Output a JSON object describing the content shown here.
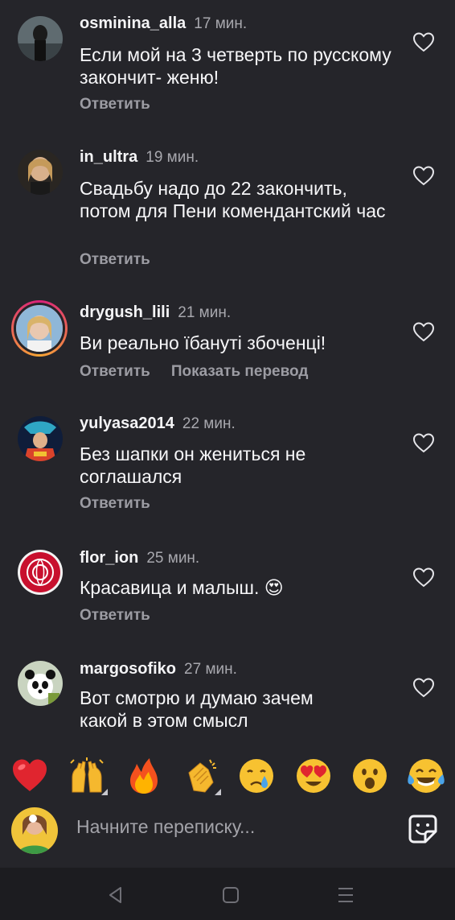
{
  "comments": [
    {
      "username": "osminina_alla",
      "time": "17 мин.",
      "text": "Если мой на 3 четверть по русскому закончит- женю!",
      "actions": [
        "Ответить"
      ]
    },
    {
      "username": "in_ultra",
      "time": "19 мин.",
      "text": "Свадьбу надо до 22 закончить, потом для Пени комендантский час",
      "actions": [
        "Ответить"
      ]
    },
    {
      "username": "drygush_lili",
      "time": "21 мин.",
      "text": "Ви реально їбануті збоченці!",
      "actions": [
        "Ответить",
        "Показать перевод"
      ]
    },
    {
      "username": "yulyasa2014",
      "time": "22 мин.",
      "text": "Без шапки он жениться не соглашался",
      "actions": [
        "Ответить"
      ]
    },
    {
      "username": "flor_ion",
      "time": "25 мин.",
      "text": "Красавица и малыш. 😍",
      "actions": [
        "Ответить"
      ]
    },
    {
      "username": "margosofiko",
      "time": "27 мин.",
      "text": "Вот смотрю и думаю зачем какой в этом смысл",
      "actions": []
    }
  ],
  "reactions": [
    "❤️",
    "🙌",
    "🔥",
    "👏",
    "😢",
    "😍",
    "😮",
    "😂"
  ],
  "composer": {
    "placeholder": "Начните переписку..."
  },
  "icons": {
    "like": "heart-icon",
    "sticker": "sticker-icon",
    "back": "back-icon",
    "home": "home-icon",
    "menu": "menu-icon"
  },
  "colors": {
    "background": "#25252a",
    "text": "#f2f2f5",
    "muted": "#a8a8ae",
    "navbar": "#1c1c20"
  }
}
